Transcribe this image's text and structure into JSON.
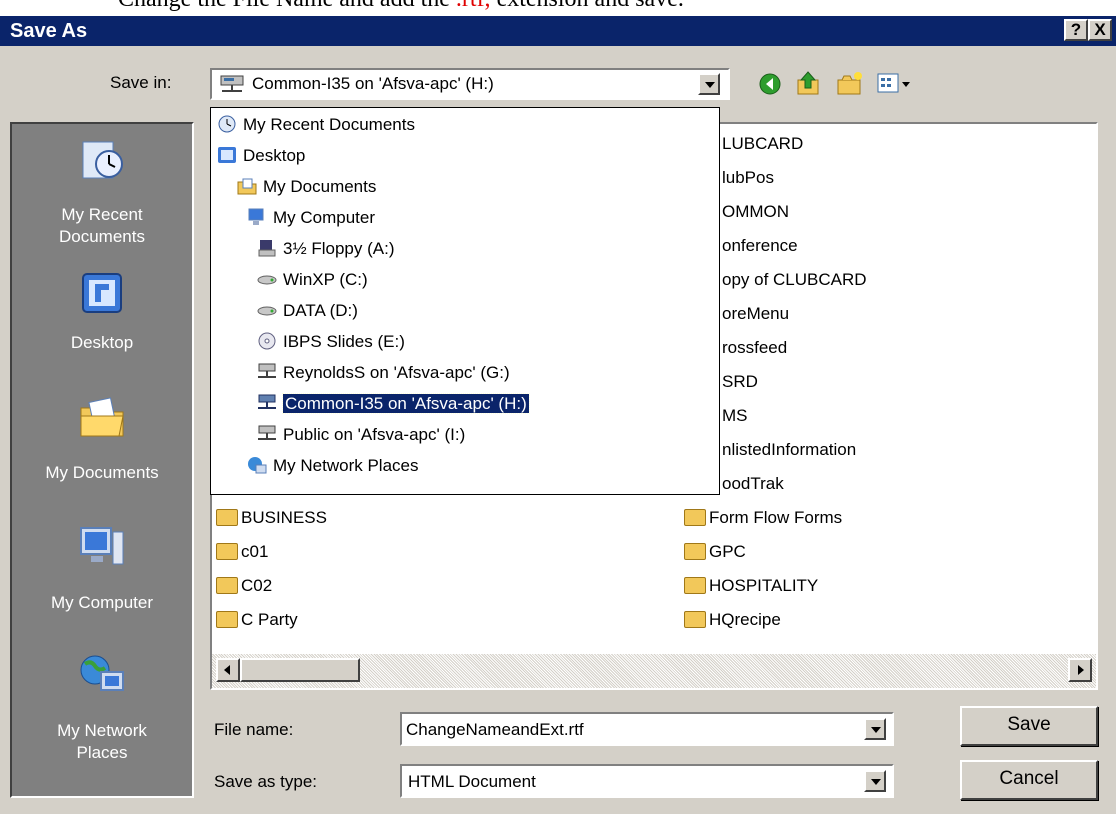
{
  "instruction": {
    "text_before": "Change the File Name and add the ",
    "highlight": ".rtf,",
    "text_after": " extension and save."
  },
  "window": {
    "title": "Save As",
    "help_label": "?",
    "close_label": "X"
  },
  "save_in": {
    "label": "Save in:",
    "value": "Common-I35 on 'Afsva-apc' (H:)"
  },
  "places": [
    {
      "label1": "My Recent",
      "label2": "Documents"
    },
    {
      "label1": "Desktop",
      "label2": ""
    },
    {
      "label1": "My Documents",
      "label2": ""
    },
    {
      "label1": "My Computer",
      "label2": ""
    },
    {
      "label1": "My Network",
      "label2": "Places"
    }
  ],
  "dropdown_items": [
    {
      "label": "My Recent Documents",
      "icon": "recent-documents-icon"
    },
    {
      "label": "Desktop",
      "icon": "desktop-icon"
    },
    {
      "label": "My Documents",
      "icon": "my-documents-icon"
    },
    {
      "label": "My Computer",
      "icon": "my-computer-icon"
    },
    {
      "label": "3½ Floppy (A:)",
      "icon": "floppy-icon"
    },
    {
      "label": "WinXP (C:)",
      "icon": "drive-icon"
    },
    {
      "label": "DATA (D:)",
      "icon": "drive-icon"
    },
    {
      "label": "IBPS Slides (E:)",
      "icon": "cd-icon"
    },
    {
      "label": "ReynoldsS on 'Afsva-apc' (G:)",
      "icon": "network-drive-icon"
    },
    {
      "label": "Common-I35 on 'Afsva-apc' (H:)",
      "icon": "network-drive-icon"
    },
    {
      "label": "Public on 'Afsva-apc' (I:)",
      "icon": "network-drive-icon"
    },
    {
      "label": "My Network Places",
      "icon": "network-places-icon"
    }
  ],
  "files_right_partial": [
    "LUBCARD",
    "lubPos",
    "OMMON",
    "onference",
    "opy of CLUBCARD",
    "oreMenu",
    "rossfeed",
    "SRD",
    "MS",
    "nlistedInformation",
    "oodTrak"
  ],
  "files_left": [
    "BUSINESS",
    "c01",
    "C02",
    "C Party"
  ],
  "files_right": [
    "Form Flow Forms",
    "GPC",
    "HOSPITALITY",
    "HQrecipe"
  ],
  "file_name": {
    "label": "File name:",
    "value": "ChangeNameandExt.rtf"
  },
  "save_type": {
    "label": "Save as type:",
    "value": "HTML Document"
  },
  "buttons": {
    "save": "Save",
    "cancel": "Cancel"
  }
}
